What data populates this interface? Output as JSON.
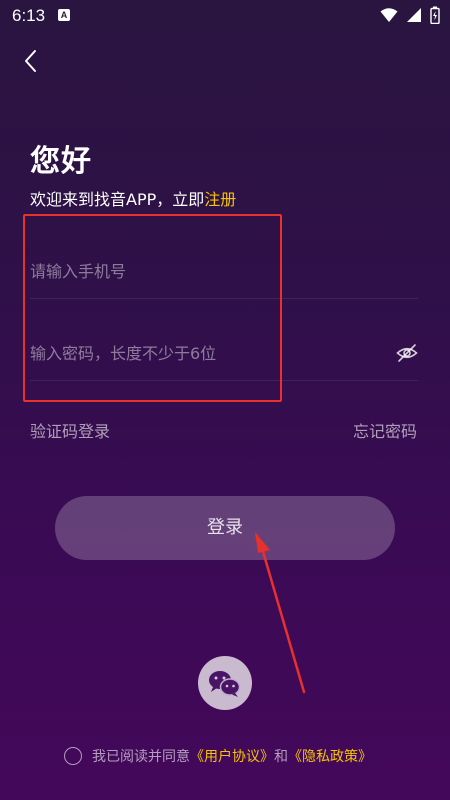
{
  "status_bar": {
    "time": "6:13",
    "badge": "A"
  },
  "header": {
    "greeting": "您好",
    "welcome_prefix": "欢迎来到找音APP，立即",
    "register_link": "注册"
  },
  "form": {
    "phone_placeholder": "请输入手机号",
    "password_placeholder": "输入密码，长度不少于6位"
  },
  "links": {
    "sms_login": "验证码登录",
    "forgot_password": "忘记密码"
  },
  "login_button": "登录",
  "agreement": {
    "prefix": "我已阅读并同意",
    "user_agreement": "《用户协议》",
    "and": "和",
    "privacy_policy": "《隐私政策》"
  },
  "colors": {
    "accent": "#f4c400",
    "annotation": "#e8302c",
    "background_top": "#2a1540",
    "background_bottom": "#44085a"
  },
  "icons": {
    "back": "chevron-left-icon",
    "password_toggle": "eye-off-icon",
    "wechat": "wechat-icon",
    "wifi": "wifi-icon",
    "signal": "signal-icon",
    "battery": "battery-icon"
  }
}
